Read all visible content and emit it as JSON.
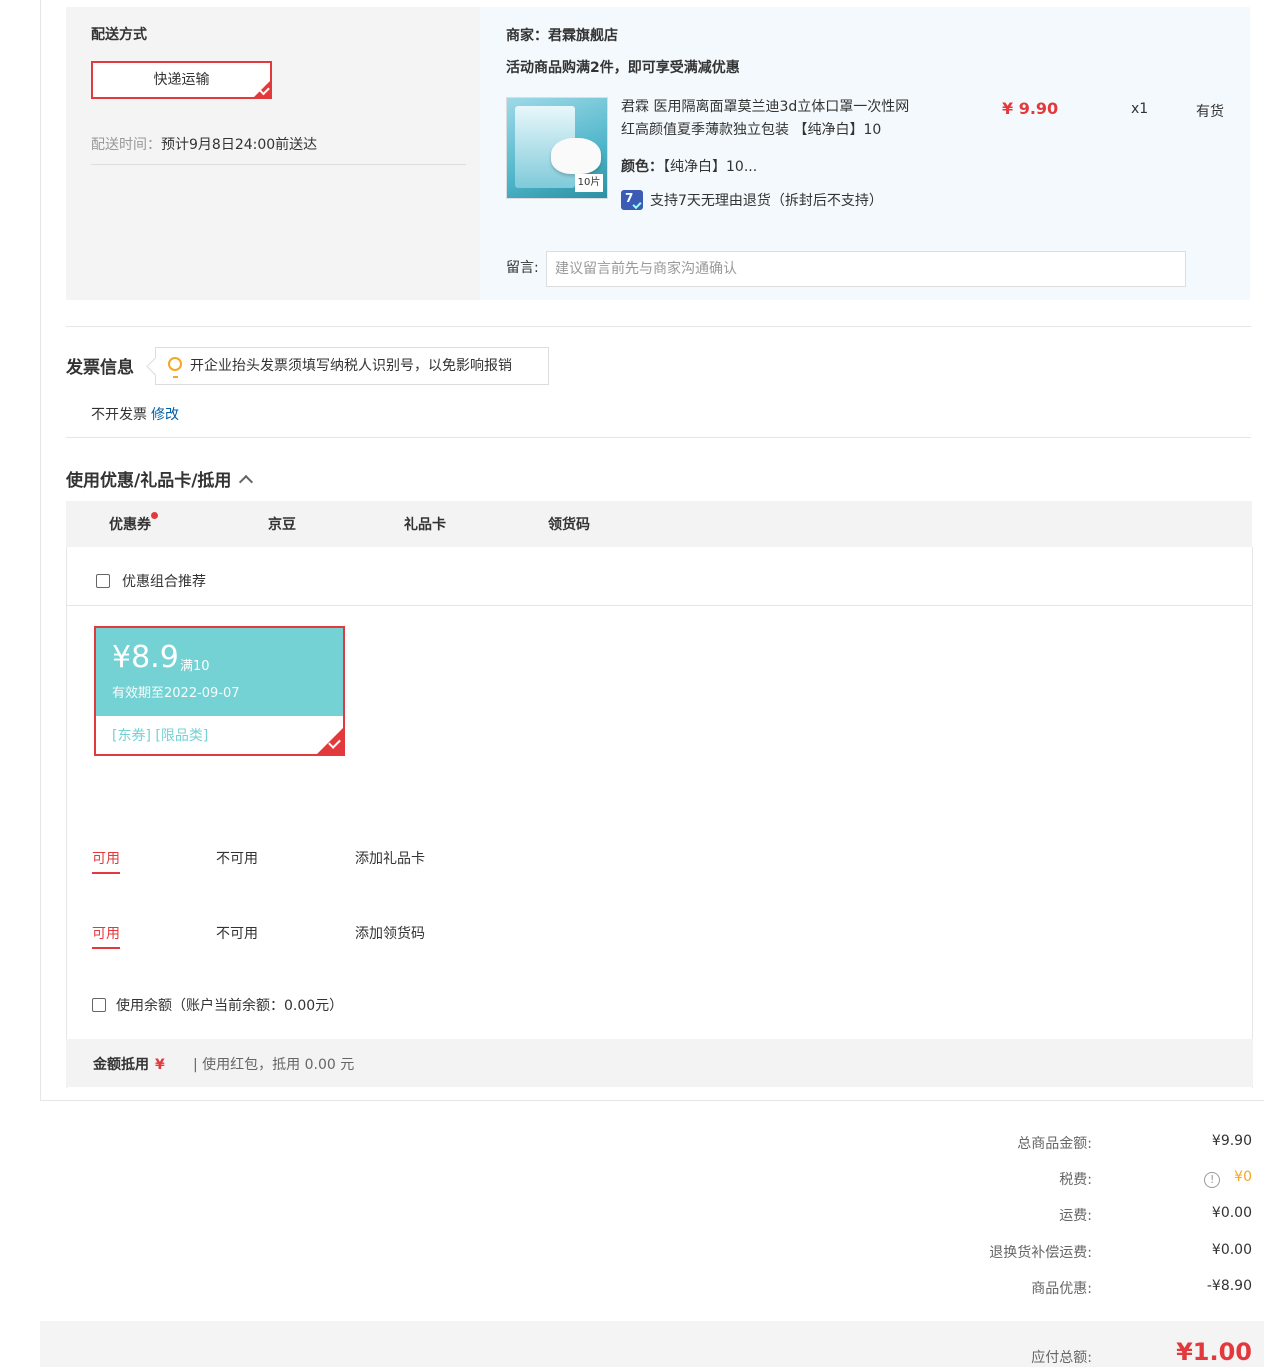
{
  "shipping": {
    "title": "配送方式",
    "method_button": "快递运输",
    "time_label": "配送时间：",
    "time_value": "预计9月8日24:00前送达"
  },
  "order": {
    "shop": "商家：君霖旗舰店",
    "promo": "活动商品购满2件，即可享受满减优惠",
    "product_name": "君霖 医用隔离面罩莫兰迪3d立体口罩一次性网红高颜值夏季薄款独立包装 【纯净白】10",
    "color_label": "颜色：",
    "color_value": "【纯净白】10...",
    "return_policy": "支持7天无理由退货（拆封后不支持）",
    "price": "¥ 9.90",
    "quantity": "x1",
    "stock": "有货",
    "image_tag": "10片",
    "remark_label": "留言:",
    "remark_placeholder": "建议留言前先与商家沟通确认"
  },
  "invoice": {
    "title": "发票信息",
    "tip": "开企业抬头发票须填写纳税人识别号，以免影响报销",
    "status": "不开发票",
    "edit": "修改"
  },
  "discounts": {
    "title": "使用优惠/礼品卡/抵用",
    "tabs": [
      "优惠券",
      "京豆",
      "礼品卡",
      "领货码"
    ],
    "combo_label": "优惠组合推荐",
    "coupon": {
      "amount": "¥8.9",
      "condition": "满10",
      "expiry": "有效期至2022-09-07",
      "tags": "[东券] [限品类]"
    },
    "giftcard_tabs": [
      "可用",
      "不可用",
      "添加礼品卡"
    ],
    "code_tabs": [
      "可用",
      "不可用",
      "添加领货码"
    ],
    "balance_label": "使用余额（账户当前余额：0.00元）",
    "amount_label": "金额抵用",
    "amount_yen": "¥",
    "amount_desc": "| 使用红包，抵用 0.00 元"
  },
  "summary": {
    "items": [
      {
        "label": "总商品金额:",
        "value": "¥9.90"
      },
      {
        "label": "税费:",
        "value": "¥0"
      },
      {
        "label": "运费:",
        "value": "¥0.00"
      },
      {
        "label": "退换货补偿运费:",
        "value": "¥0.00"
      },
      {
        "label": "商品优惠:",
        "value": "-¥8.90"
      }
    ],
    "pay_label": "应付总额:",
    "pay_value": "¥1.00"
  },
  "colors": {
    "accent_red": "#e4393c",
    "coupon_teal": "#74d2d4",
    "link_blue": "#005ea7"
  }
}
